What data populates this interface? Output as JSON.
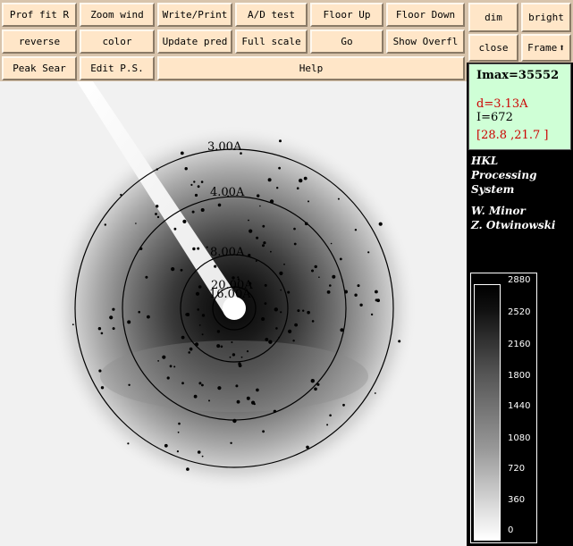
{
  "toolbar": {
    "row1": [
      "Prof fit R",
      "Zoom wind",
      "Write/Print",
      "A/D test",
      "Floor Up",
      "Floor Down"
    ],
    "row2": [
      "reverse",
      "color",
      "Update pred",
      "Full scale",
      "Go",
      "Show Overfl"
    ],
    "row3": [
      "Peak Sear",
      "Edit P.S.",
      "Help"
    ]
  },
  "right_buttons": {
    "dim": "dim",
    "bright": "bright",
    "close": "close",
    "frame": "Frame"
  },
  "info": {
    "imax": "Imax=35552",
    "d": "d=3.13A",
    "intensity": "I=672",
    "coords": "[28.8 ,21.7 ]",
    "colors": {
      "highlight": "#cc0000",
      "panel_bg": "#cfffd6"
    }
  },
  "credits": {
    "title_lines": [
      "HKL",
      "Processing",
      "System"
    ],
    "authors": [
      "W. Minor",
      "Z. Otwinowski"
    ]
  },
  "resolution_rings": [
    "3.00A",
    "4.00A",
    "8.00A",
    "20.00A",
    "16.00A"
  ],
  "intensity_scale": [
    "2880",
    "2520",
    "2160",
    "1800",
    "1440",
    "1080",
    "720",
    "360",
    "0"
  ]
}
